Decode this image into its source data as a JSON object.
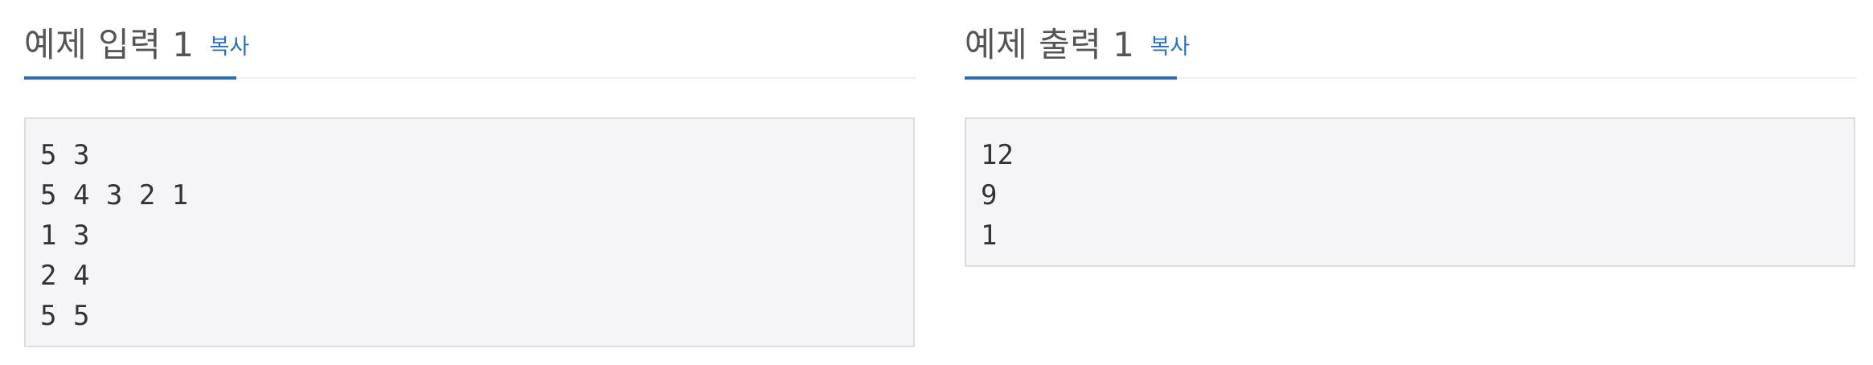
{
  "sample_input": {
    "title": "예제 입력 1",
    "copy_label": "복사",
    "content": "5 3\n5 4 3 2 1\n1 3\n2 4\n5 5"
  },
  "sample_output": {
    "title": "예제 출력 1",
    "copy_label": "복사",
    "content": "12\n9\n1"
  },
  "colors": {
    "accent": "#2f6dae",
    "link": "#2a70b8",
    "sample_background": "#f5f5f7",
    "sample_border": "#dddddd",
    "divider": "#eeeeee"
  }
}
